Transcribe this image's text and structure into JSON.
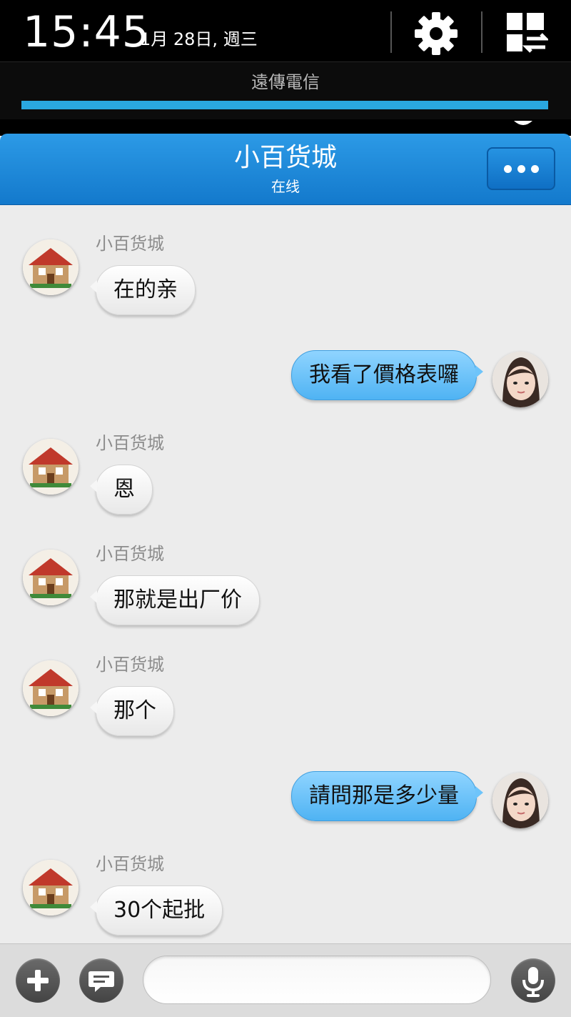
{
  "status_bar": {
    "time": "15:45",
    "date": "1月 28日, 週三",
    "carrier": "遠傳電信",
    "icons": [
      "gear-icon",
      "quick-settings-icon"
    ]
  },
  "chat_header": {
    "title": "小百货城",
    "status": "在线",
    "menu_icon": "more-dots-icon",
    "accent_color": "#1e88d8"
  },
  "messages": [
    {
      "direction": "in",
      "sender": "小百货城",
      "text": "在的亲"
    },
    {
      "direction": "out",
      "text": "我看了價格表囉"
    },
    {
      "direction": "in",
      "sender": "小百货城",
      "text": "恩"
    },
    {
      "direction": "in",
      "sender": "小百货城",
      "text": "那就是出厂价"
    },
    {
      "direction": "in",
      "sender": "小百货城",
      "text": "那个"
    },
    {
      "direction": "out",
      "text": "請問那是多少量"
    },
    {
      "direction": "in",
      "sender": "小百货城",
      "text": "30个起批"
    }
  ],
  "input_bar": {
    "input_value": "",
    "icons": [
      "plus-icon",
      "message-icon",
      "microphone-icon"
    ]
  }
}
